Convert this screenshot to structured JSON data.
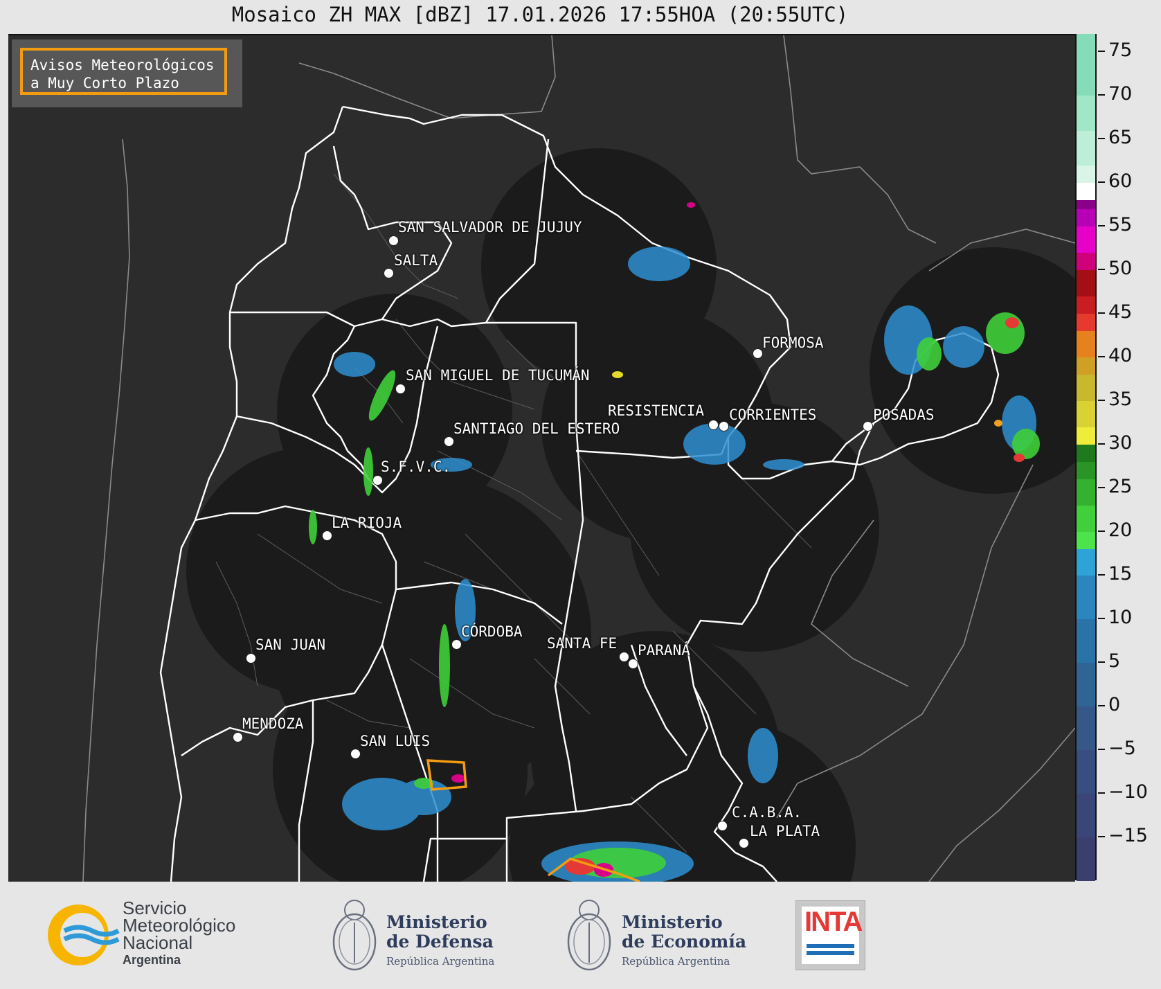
{
  "header": {
    "title": "Mosaico ZH MAX [dBZ] 17.01.2026 17:55HOA (20:55UTC)"
  },
  "alert_legend": {
    "line1": "Avisos Meteorológicos",
    "line2": "a Muy Corto Plazo",
    "border_color": "#f39c12"
  },
  "cities": [
    {
      "name": "SAN SALVADOR DE JUJUY"
    },
    {
      "name": "SALTA"
    },
    {
      "name": "SAN MIGUEL DE TUCUMÁN"
    },
    {
      "name": "SANTIAGO DEL ESTERO"
    },
    {
      "name": "FORMOSA"
    },
    {
      "name": "RESISTENCIA"
    },
    {
      "name": "CORRIENTES"
    },
    {
      "name": "POSADAS"
    },
    {
      "name": "S.F.V.C."
    },
    {
      "name": "LA RIOJA"
    },
    {
      "name": "SAN JUAN"
    },
    {
      "name": "CÓRDOBA"
    },
    {
      "name": "SANTA FE"
    },
    {
      "name": "PARANÁ"
    },
    {
      "name": "MENDOZA"
    },
    {
      "name": "SAN LUIS"
    },
    {
      "name": "C.A.B.A."
    },
    {
      "name": "LA PLATA"
    }
  ],
  "colorbar": {
    "unit": "dBZ",
    "range": [
      -20,
      77
    ],
    "ticks": [
      "75",
      "70",
      "65",
      "60",
      "55",
      "50",
      "45",
      "40",
      "35",
      "30",
      "25",
      "20",
      "15",
      "10",
      "5",
      "0",
      "−5",
      "−10",
      "−15"
    ]
  },
  "logos": {
    "smn": {
      "line1": "Servicio",
      "line2": "Meteorológico",
      "line3": "Nacional",
      "sub": "Argentina"
    },
    "defensa": {
      "line1": "Ministerio",
      "line2": "de Defensa",
      "sub": "República Argentina"
    },
    "economia": {
      "line1": "Ministerio",
      "line2": "de Economía",
      "sub": "República Argentina"
    },
    "inta": {
      "word": "INTA"
    }
  }
}
